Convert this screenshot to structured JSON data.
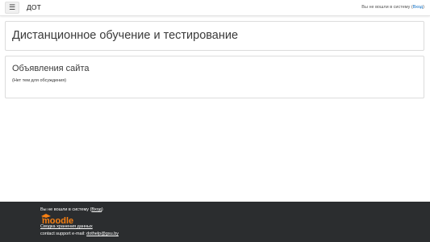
{
  "navbar": {
    "menu_icon": "hamburger-icon",
    "brand": "ДОТ",
    "login_prefix": "Вы не вошли в систему (",
    "login_link": "Вход",
    "login_suffix": ")"
  },
  "header": {
    "title": "Дистанционное обучение и тестирование"
  },
  "news": {
    "title": "Объявления сайта",
    "empty_text": "(Нет тем для обсуждения)"
  },
  "footer": {
    "login_prefix": "Вы не вошли в систему (",
    "login_link": "Вход",
    "login_suffix": ")",
    "logo_text": "moodle",
    "data_retention_link": "Сводка хранения данных",
    "contact_prefix": "contact support e-mail: ",
    "contact_email": "dothelp@gsu.by"
  },
  "colors": {
    "link": "#0f6fc5",
    "footer_bg": "#2b2d2f",
    "moodle_orange": "#f98012"
  }
}
